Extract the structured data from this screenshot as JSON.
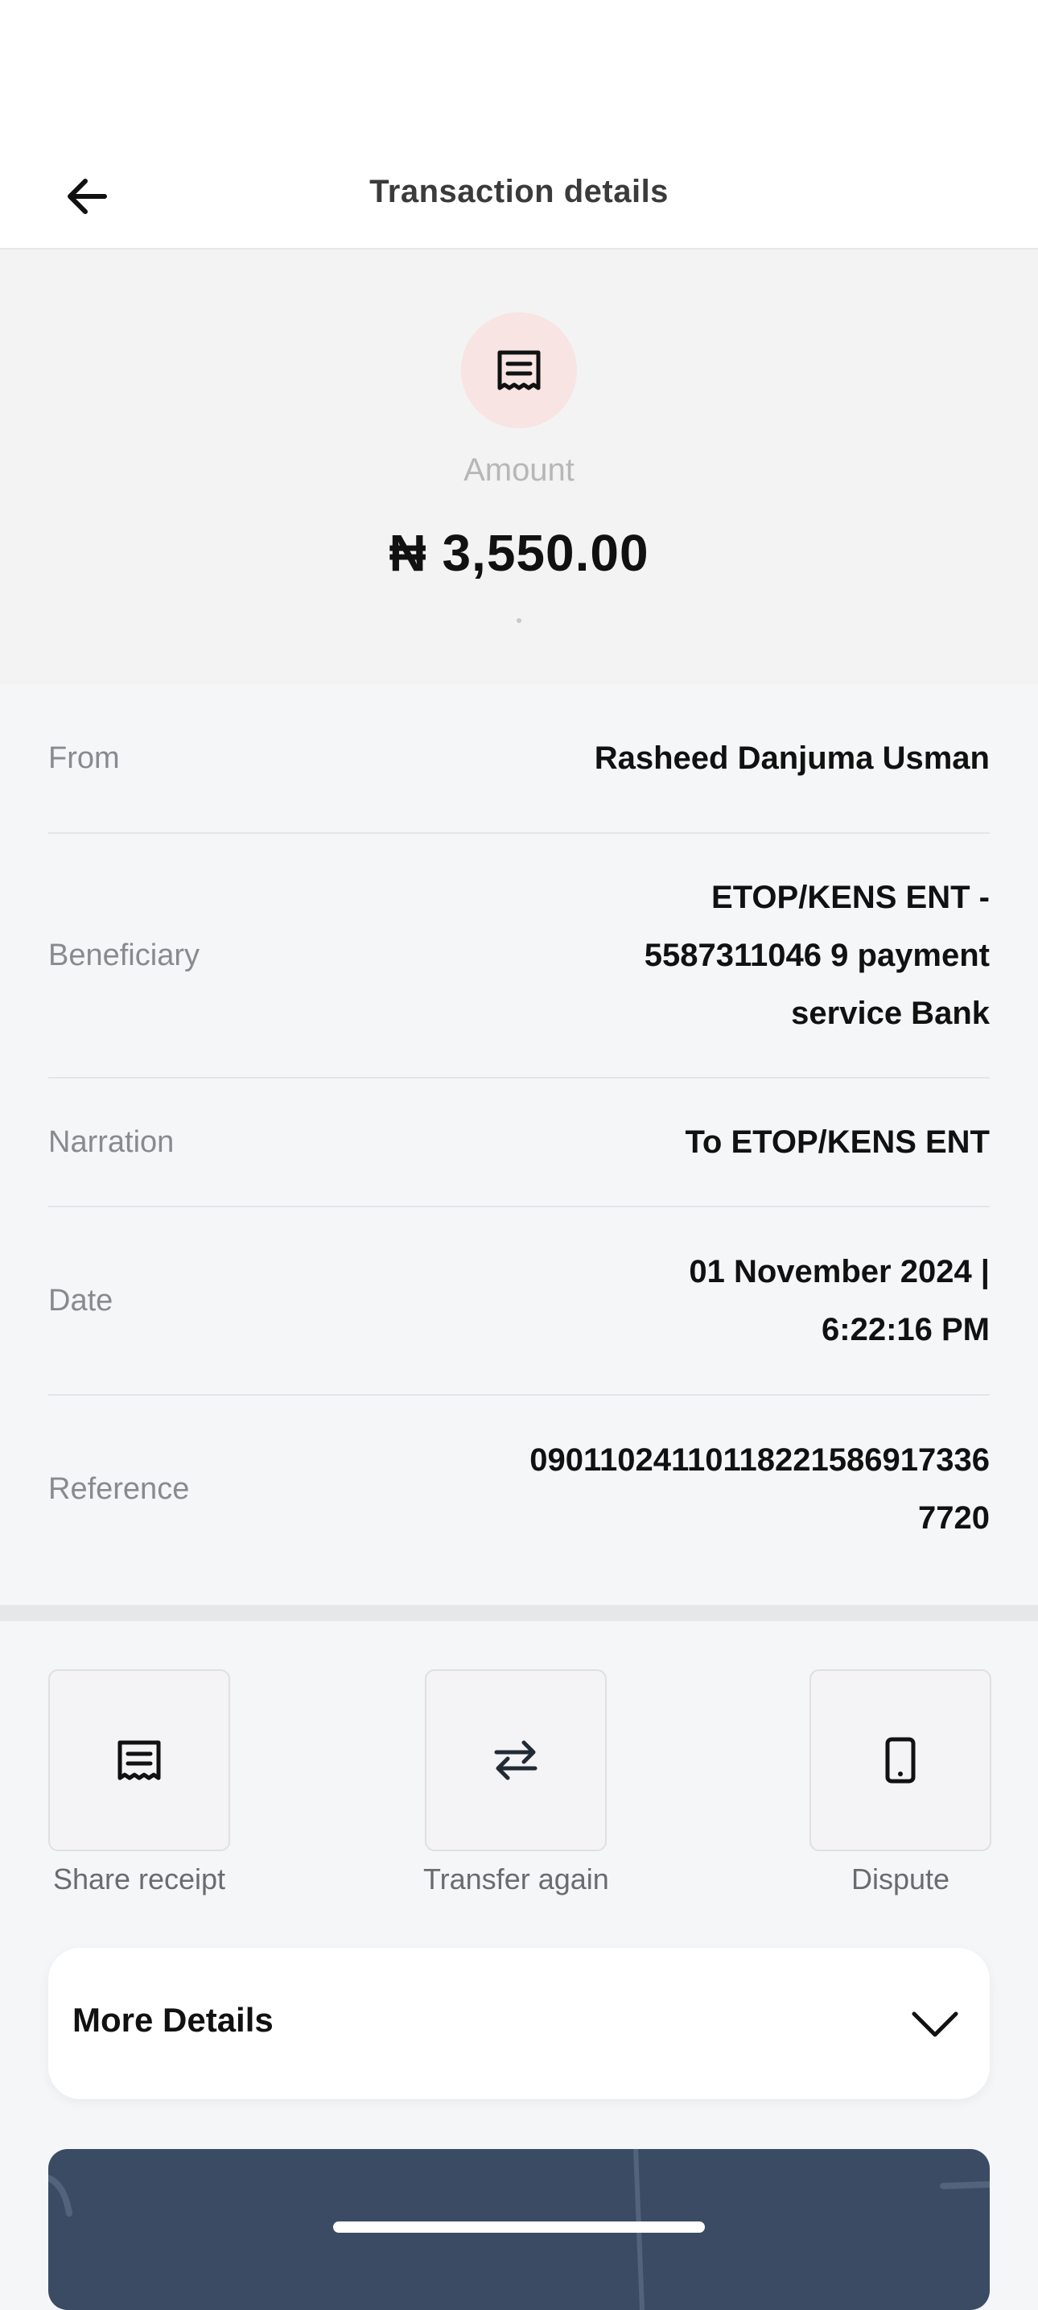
{
  "header": {
    "title": "Transaction details"
  },
  "summary": {
    "amount_label": "Amount",
    "amount_value": "₦ 3,550.00"
  },
  "details": [
    {
      "label": "From",
      "value": "Rasheed Danjuma Usman"
    },
    {
      "label": "Beneficiary",
      "value": "ETOP/KENS ENT - 5587311046 9 payment service Bank"
    },
    {
      "label": "Narration",
      "value": "To ETOP/KENS ENT"
    },
    {
      "label": "Date",
      "value": "01 November 2024 | 6:22:16 PM"
    },
    {
      "label": "Reference",
      "value": "090110241101182215869173367720"
    }
  ],
  "actions": {
    "share_label": "Share receipt",
    "transfer_label": "Transfer again",
    "dispute_label": "Dispute"
  },
  "more_details": {
    "label": "More Details"
  },
  "colors": {
    "receipt_circle_bg": "#f7e4e3",
    "banner_bg": "#3b4b64",
    "page_bg": "#f5f6f8"
  },
  "icons": {
    "back": "arrow-left-icon",
    "receipt": "receipt-icon",
    "transfer": "swap-arrows-icon",
    "dispute": "phone-icon",
    "expand": "chevron-down-icon"
  }
}
